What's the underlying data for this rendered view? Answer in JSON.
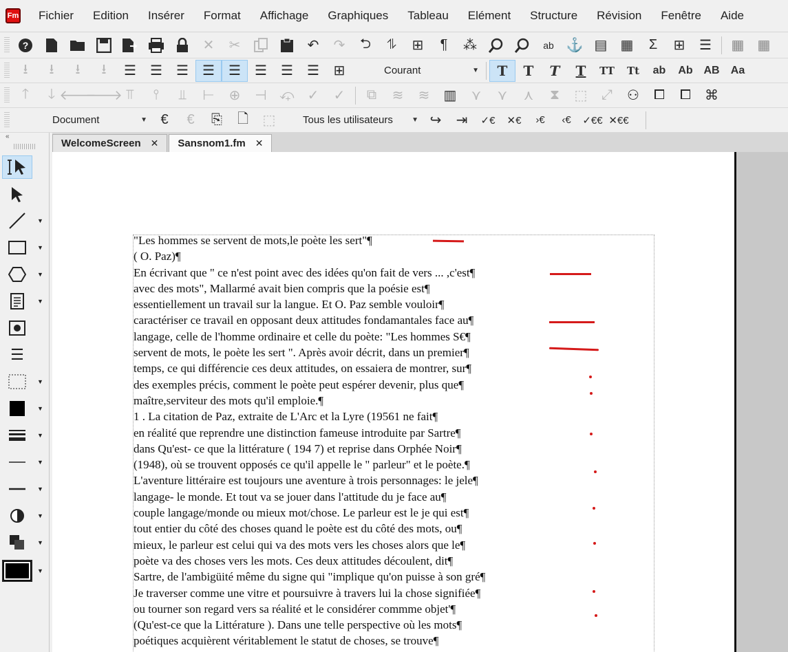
{
  "app": {
    "logo": "Fm"
  },
  "menu": [
    "Fichier",
    "Edition",
    "Insérer",
    "Format",
    "Affichage",
    "Graphiques",
    "Tableau",
    "Elément",
    "Structure",
    "Révision",
    "Fenêtre",
    "Aide"
  ],
  "toolbar_format": {
    "paragraph_style": "Courant",
    "text_styles": [
      "T",
      "T",
      "T",
      "T",
      "TT",
      "Tt",
      "ab",
      "Ab",
      "AB",
      "Aa"
    ]
  },
  "toolbar_track": {
    "view_select": "Document",
    "users_select": "Tous les utilisateurs"
  },
  "tabs": [
    {
      "label": "WelcomeScreen",
      "close": "✕"
    },
    {
      "label": "Sansnom1.fm",
      "close": "✕"
    }
  ],
  "palette": {
    "collapse": "«"
  },
  "document": {
    "lines": [
      "\"Les hommes se servent de mots,le poète les sert\"¶",
      "( O. Paz)¶",
      "En écrivant que \" ce n'est point avec des idées qu'on fait de vers ... ,c'est¶",
      "avec des mots\", Mallarmé avait bien compris que la poésie est¶",
      "essentiellement un travail sur la langue. Et O. Paz semble vouloir¶",
      "caractériser ce travail en opposant deux attitudes fondamantales face au¶",
      "langage, celle de l'homme ordinaire et celle du poète: \"Les hommes S€¶",
      "servent de mots, le poète les sert \". Après avoir décrit, dans un premier¶",
      "temps, ce qui différencie ces deux attitudes, on essaiera de montrer, sur¶",
      "des exemples précis, comment le poète peut espérer devenir, plus que¶",
      "maître,serviteur des mots qu'il emploie.¶",
      "1 . La citation de Paz, extraite de L'Arc et la Lyre (19561 ne fait¶",
      "en réalité que reprendre une distinction fameuse introduite par Sartre¶",
      "dans Qu'est- ce que la littérature ( 194 7) et reprise dans Orphée Noir¶",
      "(1948), où se trouvent opposés ce qu'il appelle le \" parleur\" et le poète.¶",
      "L'aventure littéraire est toujours une aventure à trois personnages: le jele¶",
      "langage- le monde. Et tout va se jouer dans l'attitude du je face au¶",
      "couple langage/monde ou mieux mot/chose. Le parleur est le je qui est¶",
      "tout entier du côté des choses quand le poète est du côté des mots, ou¶",
      "mieux, le parleur est celui qui va des mots vers les choses alors que le¶",
      "poète va des choses vers les mots. Ces deux attitudes découlent, dit¶",
      "Sartre, de l'ambigüité même du signe qui \"implique qu'on puisse à son gré¶",
      "Je traverser comme une vitre et poursuivre à travers lui la chose signifiée¶",
      "ou tourner son regard vers sa réalité et le considérer commme objet'¶",
      "(Qu'est-ce que la Littérature ). Dans une telle perspective où les mots¶",
      "poétiques acquièrent véritablement le statut de choses, se trouve¶"
    ]
  },
  "colors": {
    "annotation": "#d51a1a",
    "selection": "#cce4f7"
  }
}
